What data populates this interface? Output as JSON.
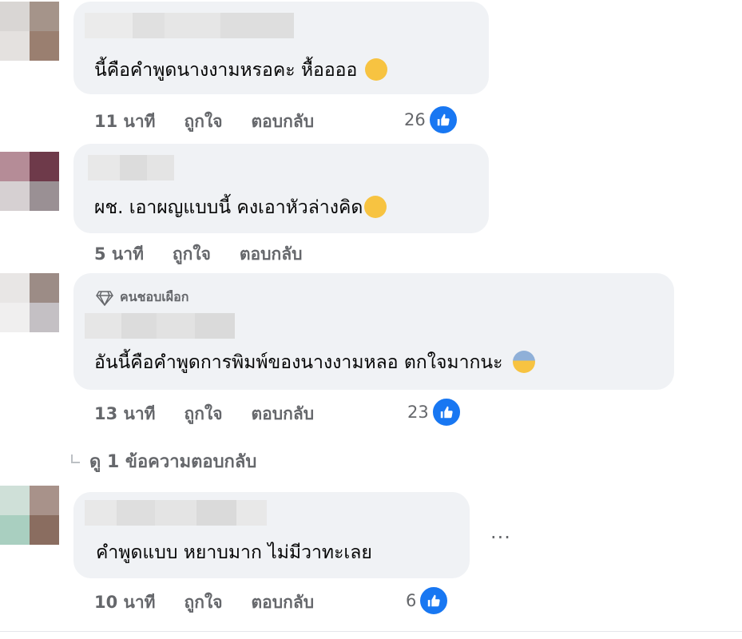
{
  "comments": [
    {
      "text": "นี้คือคำพูดนางงามหรอคะ หื้ออออ",
      "emoji": "laughing-squint-emoji",
      "time": "11 นาที",
      "like_label": "ถูกใจ",
      "reply_label": "ตอบกลับ",
      "reactions": "26"
    },
    {
      "text": "ผช. เอาผญแบบนี้ คงเอาหัวล่างคิด",
      "emoji": "eye-roll-emoji",
      "time": "5 นาที",
      "like_label": "ถูกใจ",
      "reply_label": "ตอบกลับ",
      "reactions": ""
    },
    {
      "badge": "คนชอบเผือก",
      "badge_icon": "diamond-icon",
      "text": "อันนี้คือคำพูดการพิมพ์ของนางงามหลอ ตกใจมากนะ",
      "emoji": "anxious-face-emoji",
      "time": "13 นาที",
      "like_label": "ถูกใจ",
      "reply_label": "ตอบกลับ",
      "reactions": "23"
    },
    {
      "text": "คำพูดแบบ หยาบมาก ไม่มีวาทะเลย",
      "time": "10 นาที",
      "like_label": "ถูกใจ",
      "reply_label": "ตอบกลับ",
      "reactions": "6"
    }
  ],
  "view_replies": "ดู 1 ข้อความตอบกลับ",
  "more_options": "...",
  "colors": {
    "bubble": "#f0f2f5",
    "meta": "#65676b",
    "like_blue": "#1877f2"
  }
}
